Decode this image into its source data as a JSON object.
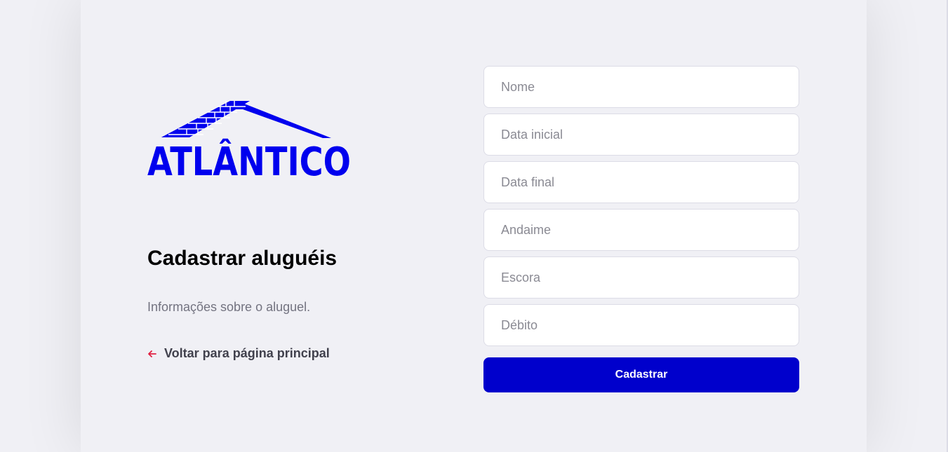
{
  "logo": {
    "text": "ATLÂNTICO",
    "color": "#0000ee"
  },
  "page": {
    "title": "Cadastrar aluguéis",
    "description": "Informações sobre o aluguel."
  },
  "back_link": {
    "label": "Voltar para página principal",
    "icon": "arrow-left-icon",
    "icon_color": "#e02041"
  },
  "form": {
    "fields": [
      {
        "placeholder": "Nome",
        "value": ""
      },
      {
        "placeholder": "Data inicial",
        "value": ""
      },
      {
        "placeholder": "Data final",
        "value": ""
      },
      {
        "placeholder": "Andaime",
        "value": ""
      },
      {
        "placeholder": "Escora",
        "value": ""
      },
      {
        "placeholder": "Débito",
        "value": ""
      }
    ],
    "submit_label": "Cadastrar",
    "submit_color": "#0000cc"
  },
  "colors": {
    "background": "#f0f0f5",
    "title": "#000000",
    "description": "#737380",
    "link": "#41414d"
  }
}
